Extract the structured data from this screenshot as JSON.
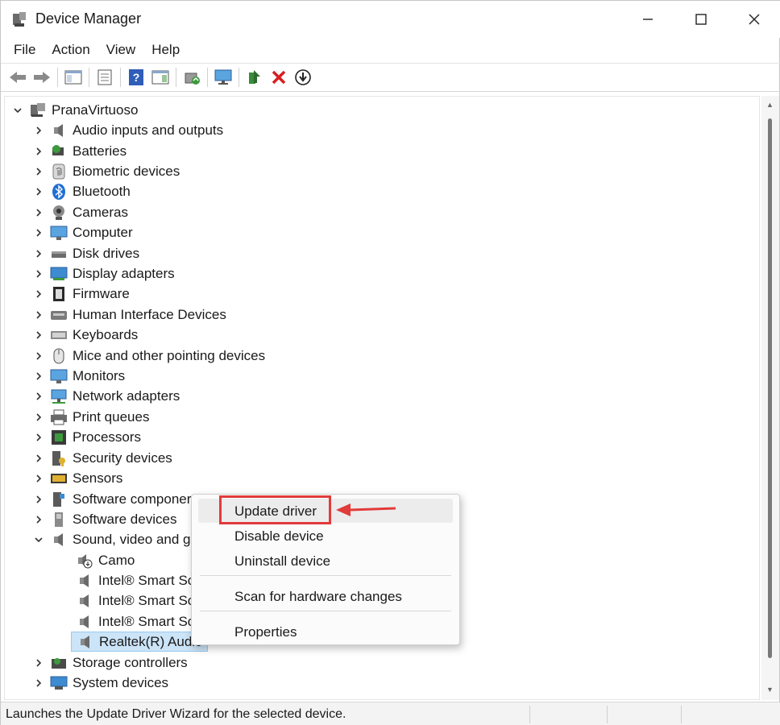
{
  "window": {
    "title": "Device Manager",
    "controls": {
      "minimize": "—",
      "maximize": "☐",
      "close": "✕"
    }
  },
  "menu": [
    "File",
    "Action",
    "View",
    "Help"
  ],
  "toolbar": [
    "back-icon",
    "forward-icon",
    "console-tree-icon",
    "properties-icon",
    "help-icon",
    "action-pane-icon",
    "update-driver-icon",
    "monitor-icon",
    "enable-device-icon",
    "uninstall-icon",
    "download-icon"
  ],
  "tree": {
    "root": "PranaVirtuoso",
    "categories": [
      "Audio inputs and outputs",
      "Batteries",
      "Biometric devices",
      "Bluetooth",
      "Cameras",
      "Computer",
      "Disk drives",
      "Display adapters",
      "Firmware",
      "Human Interface Devices",
      "Keyboards",
      "Mice and other pointing devices",
      "Monitors",
      "Network adapters",
      "Print queues",
      "Processors",
      "Security devices",
      "Sensors",
      "Software componer",
      "Software devices",
      "Sound, video and g"
    ],
    "sound_children": [
      "Camo",
      "Intel® Smart So",
      "Intel® Smart So",
      "Intel® Smart So",
      "Realtek(R) Audic"
    ],
    "after": [
      "Storage controllers",
      "System devices"
    ]
  },
  "context_menu": {
    "items": [
      "Update driver",
      "Disable device",
      "Uninstall device",
      "Scan for hardware changes",
      "Properties"
    ]
  },
  "status": "Launches the Update Driver Wizard for the selected device.",
  "colors": {
    "highlight": "#e23b3b",
    "selection": "#cce4f7"
  }
}
